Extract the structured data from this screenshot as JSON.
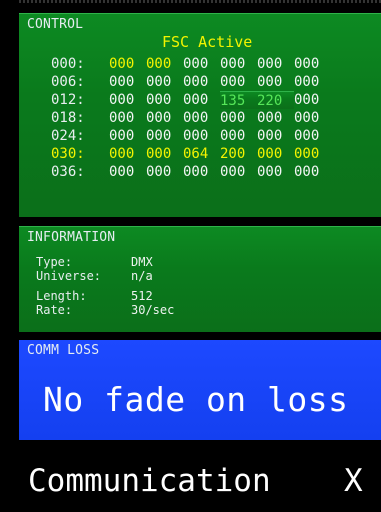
{
  "control": {
    "title": "CONTROL",
    "status": "FSC Active",
    "rows": [
      {
        "addr": "000:",
        "addr_color": "white",
        "cells": [
          {
            "v": "000",
            "c": "yellow"
          },
          {
            "v": "000",
            "c": "yellow"
          },
          {
            "v": "000",
            "c": "white"
          },
          {
            "v": "000",
            "c": "white"
          },
          {
            "v": "000",
            "c": "white"
          },
          {
            "v": "000",
            "c": "white"
          }
        ]
      },
      {
        "addr": "006:",
        "addr_color": "white",
        "cells": [
          {
            "v": "000",
            "c": "white"
          },
          {
            "v": "000",
            "c": "white"
          },
          {
            "v": "000",
            "c": "white"
          },
          {
            "v": "000",
            "c": "white"
          },
          {
            "v": "000",
            "c": "white"
          },
          {
            "v": "000",
            "c": "white"
          }
        ]
      },
      {
        "addr": "012:",
        "addr_color": "white",
        "cells": [
          {
            "v": "000",
            "c": "white"
          },
          {
            "v": "000",
            "c": "white"
          },
          {
            "v": "000",
            "c": "white"
          },
          {
            "v": "135",
            "c": "green"
          },
          {
            "v": "220",
            "c": "green"
          },
          {
            "v": "000",
            "c": "white"
          }
        ]
      },
      {
        "addr": "018:",
        "addr_color": "white",
        "cells": [
          {
            "v": "000",
            "c": "white"
          },
          {
            "v": "000",
            "c": "white"
          },
          {
            "v": "000",
            "c": "white"
          },
          {
            "v": "000",
            "c": "white"
          },
          {
            "v": "000",
            "c": "white"
          },
          {
            "v": "000",
            "c": "white"
          }
        ]
      },
      {
        "addr": "024:",
        "addr_color": "white",
        "cells": [
          {
            "v": "000",
            "c": "white"
          },
          {
            "v": "000",
            "c": "white"
          },
          {
            "v": "000",
            "c": "white"
          },
          {
            "v": "000",
            "c": "white"
          },
          {
            "v": "000",
            "c": "white"
          },
          {
            "v": "000",
            "c": "white"
          }
        ]
      },
      {
        "addr": "030:",
        "addr_color": "yellow",
        "cells": [
          {
            "v": "000",
            "c": "yellow"
          },
          {
            "v": "000",
            "c": "yellow"
          },
          {
            "v": "064",
            "c": "yellow"
          },
          {
            "v": "200",
            "c": "yellow"
          },
          {
            "v": "000",
            "c": "yellow"
          },
          {
            "v": "000",
            "c": "yellow"
          }
        ]
      },
      {
        "addr": "036:",
        "addr_color": "white",
        "cells": [
          {
            "v": "000",
            "c": "white"
          },
          {
            "v": "000",
            "c": "white"
          },
          {
            "v": "000",
            "c": "white"
          },
          {
            "v": "000",
            "c": "white"
          },
          {
            "v": "000",
            "c": "white"
          },
          {
            "v": "000",
            "c": "white"
          }
        ]
      }
    ]
  },
  "information": {
    "title": "INFORMATION",
    "type_label": "Type:",
    "type_value": "DMX",
    "universe_label": "Universe:",
    "universe_value": "n/a",
    "length_label": "Length:",
    "length_value": "512",
    "rate_label": "Rate:",
    "rate_value": "30/sec"
  },
  "comm_loss": {
    "title": "COMM LOSS",
    "value": "No fade on loss"
  },
  "footer": {
    "label": "Communication",
    "close": "X"
  },
  "colors": {
    "panel_green": "#0b7a1d",
    "panel_blue": "#1743f5",
    "value_yellow": "#f4f401",
    "value_green": "#56e659"
  }
}
